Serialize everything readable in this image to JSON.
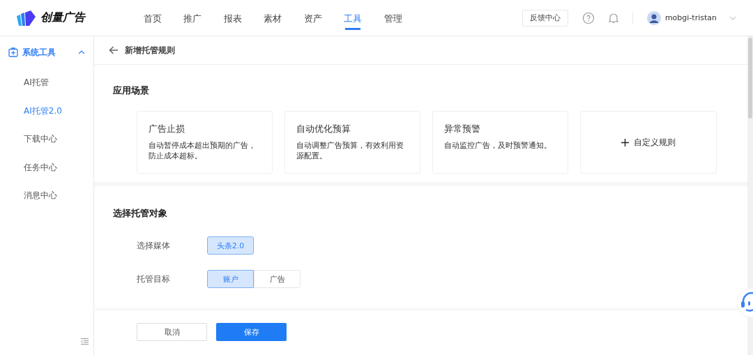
{
  "brand": {
    "name": "创量广告"
  },
  "nav": [
    {
      "label": "首页",
      "selected": false
    },
    {
      "label": "推广",
      "selected": false
    },
    {
      "label": "报表",
      "selected": false
    },
    {
      "label": "素材",
      "selected": false
    },
    {
      "label": "资产",
      "selected": false
    },
    {
      "label": "工具",
      "selected": true
    },
    {
      "label": "管理",
      "selected": false
    }
  ],
  "header_actions": {
    "feedback": "反馈中心",
    "user": "mobgi-tristan"
  },
  "sidebar": {
    "group": {
      "label": "系统工具",
      "expanded": true
    },
    "items": [
      {
        "label": "AI托管",
        "selected": false
      },
      {
        "label": "AI托管2.0",
        "selected": true
      },
      {
        "label": "下载中心",
        "selected": false
      },
      {
        "label": "任务中心",
        "selected": false
      },
      {
        "label": "消息中心",
        "selected": false
      }
    ]
  },
  "page_title": "新增托管规则",
  "scenario": {
    "title": "应用场景",
    "cards": [
      {
        "kind": "preset",
        "title": "广告止损",
        "description": "自动暂停成本超出预期的广告，防止成本超标。"
      },
      {
        "kind": "preset",
        "title": "自动优化预算",
        "description": "自动调整广告预算，有效利用资源配置。"
      },
      {
        "kind": "preset",
        "title": "异常预警",
        "description": "自动监控广告，及时预警通知。"
      },
      {
        "kind": "custom",
        "title": "自定义规则"
      }
    ]
  },
  "target": {
    "title": "选择托管对象",
    "fields": [
      {
        "label": "选择媒体",
        "options": [
          {
            "label": "头条2.0",
            "selected": true
          }
        ]
      },
      {
        "label": "托管目标",
        "options": [
          {
            "label": "账户",
            "selected": true
          },
          {
            "label": "广告",
            "selected": false
          }
        ]
      }
    ]
  },
  "footer": {
    "cancel": "取消",
    "save": "保存"
  }
}
